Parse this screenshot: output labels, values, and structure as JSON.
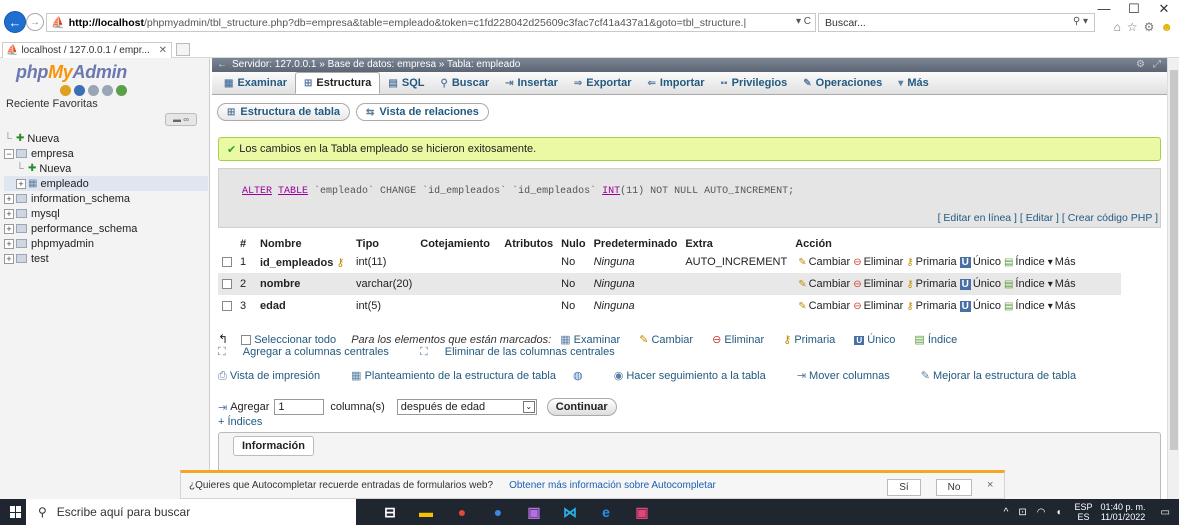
{
  "browser": {
    "url_host": "http://localhost",
    "url_rest": "/phpmyadmin/tbl_structure.php?db=empresa&table=empleado&token=c1fd228042d25609c3fac7cf41a437a1&goto=tbl_structure.|",
    "url_tail": "▾ C",
    "search_placeholder": "Buscar...",
    "tab_title": "localhost / 127.0.0.1 / empr...",
    "window_min": "—",
    "window_max": "☐",
    "window_close": "✕"
  },
  "left_panel": {
    "logo_php": "php",
    "logo_my": "My",
    "logo_admin": "Admin",
    "recent_favorites": "Reciente   Favoritas",
    "tree": [
      {
        "label": "Nueva",
        "type": "new",
        "level": 0
      },
      {
        "label": "empresa",
        "type": "db",
        "level": 0
      },
      {
        "label": "Nueva",
        "type": "new",
        "level": 1
      },
      {
        "label": "empleado",
        "type": "table",
        "level": 1
      },
      {
        "label": "information_schema",
        "type": "db",
        "level": 0
      },
      {
        "label": "mysql",
        "type": "db",
        "level": 0
      },
      {
        "label": "performance_schema",
        "type": "db",
        "level": 0
      },
      {
        "label": "phpmyadmin",
        "type": "db",
        "level": 0
      },
      {
        "label": "test",
        "type": "db",
        "level": 0
      }
    ]
  },
  "breadcrumb": "Servidor: 127.0.0.1 » Base de datos: empresa » Tabla: empleado",
  "menu_tabs": [
    {
      "label": "Examinar",
      "icon": "▦"
    },
    {
      "label": "Estructura",
      "icon": "⊞",
      "active": true
    },
    {
      "label": "SQL",
      "icon": "▤"
    },
    {
      "label": "Buscar",
      "icon": "⚲"
    },
    {
      "label": "Insertar",
      "icon": "⇥"
    },
    {
      "label": "Exportar",
      "icon": "⇒"
    },
    {
      "label": "Importar",
      "icon": "⇐"
    },
    {
      "label": "Privilegios",
      "icon": "▪▪"
    },
    {
      "label": "Operaciones",
      "icon": "✎"
    },
    {
      "label": "Más",
      "icon": "▾"
    }
  ],
  "sub_tabs": [
    {
      "label": "Estructura de tabla",
      "icon": "⊞"
    },
    {
      "label": "Vista de relaciones",
      "icon": "⇆"
    }
  ],
  "success_message": "Los cambios en la Tabla empleado se hicieron exitosamente.",
  "sql_query": {
    "alter": "ALTER",
    "table": "TABLE",
    "p1": " `empleado` CHANGE `id_empleados` `id_empleados` ",
    "int": "INT",
    "p2": "(11) NOT NULL AUTO_INCREMENT;",
    "links": "[ Editar en línea ] [ Editar ] [ Crear código PHP ]"
  },
  "table": {
    "headers": [
      "#",
      "Nombre",
      "Tipo",
      "Cotejamiento",
      "Atributos",
      "Nulo",
      "Predeterminado",
      "Extra",
      "Acción"
    ],
    "rows": [
      {
        "num": "1",
        "name": "id_empleados",
        "type": "int(11)",
        "collation": "",
        "attributes": "",
        "null": "No",
        "default": "Ninguna",
        "extra": "AUTO_INCREMENT",
        "is_key": true
      },
      {
        "num": "2",
        "name": "nombre",
        "type": "varchar(20)",
        "collation": "",
        "attributes": "",
        "null": "No",
        "default": "Ninguna",
        "extra": "",
        "is_key": false
      },
      {
        "num": "3",
        "name": "edad",
        "type": "int(5)",
        "collation": "",
        "attributes": "",
        "null": "No",
        "default": "Ninguna",
        "extra": "",
        "is_key": false
      }
    ],
    "actions": {
      "change": "Cambiar",
      "delete": "Eliminar",
      "primary": "Primaria",
      "unique": "Único",
      "index": "Índice",
      "more": "Más"
    }
  },
  "bulk": {
    "select_all": "Seleccionar todo",
    "with_selected": "Para los elementos que están marcados:",
    "browse": "Examinar",
    "change": "Cambiar",
    "delete": "Eliminar",
    "primary": "Primaria",
    "unique": "Único",
    "index": "Índice",
    "add_central": "Agregar a columnas centrales",
    "remove_central": "Eliminar de las columnas centrales"
  },
  "tools": {
    "print_view": "Vista de impresión",
    "propose_structure": "Planteamiento de la estructura de tabla",
    "track_table": "Hacer seguimiento a la tabla",
    "move_columns": "Mover columnas",
    "improve_structure": "Mejorar la estructura de tabla"
  },
  "add_columns": {
    "label": "Agregar",
    "count": "1",
    "unit": "columna(s)",
    "position": "después de edad",
    "submit": "Continuar",
    "indices": "+ Índices"
  },
  "info_legend": "Información",
  "autocomplete": {
    "question": "¿Quieres que Autocompletar recuerde entradas de formularios web?",
    "more_info": "Obtener más información sobre Autocompletar",
    "yes": "Sí",
    "no": "No",
    "close": "×"
  },
  "taskbar": {
    "search_placeholder": "Escribe aquí para buscar",
    "lang_top": "ESP",
    "lang_bottom": "ES",
    "time": "01:40 p. m.",
    "date": "11/01/2022"
  },
  "colors": {
    "pma_link": "#235a81",
    "success_bg": "#ebf8a4",
    "success_border": "#a2d246",
    "autocomplete_accent": "#f5a623",
    "taskbar_bg": "#1f2630"
  }
}
